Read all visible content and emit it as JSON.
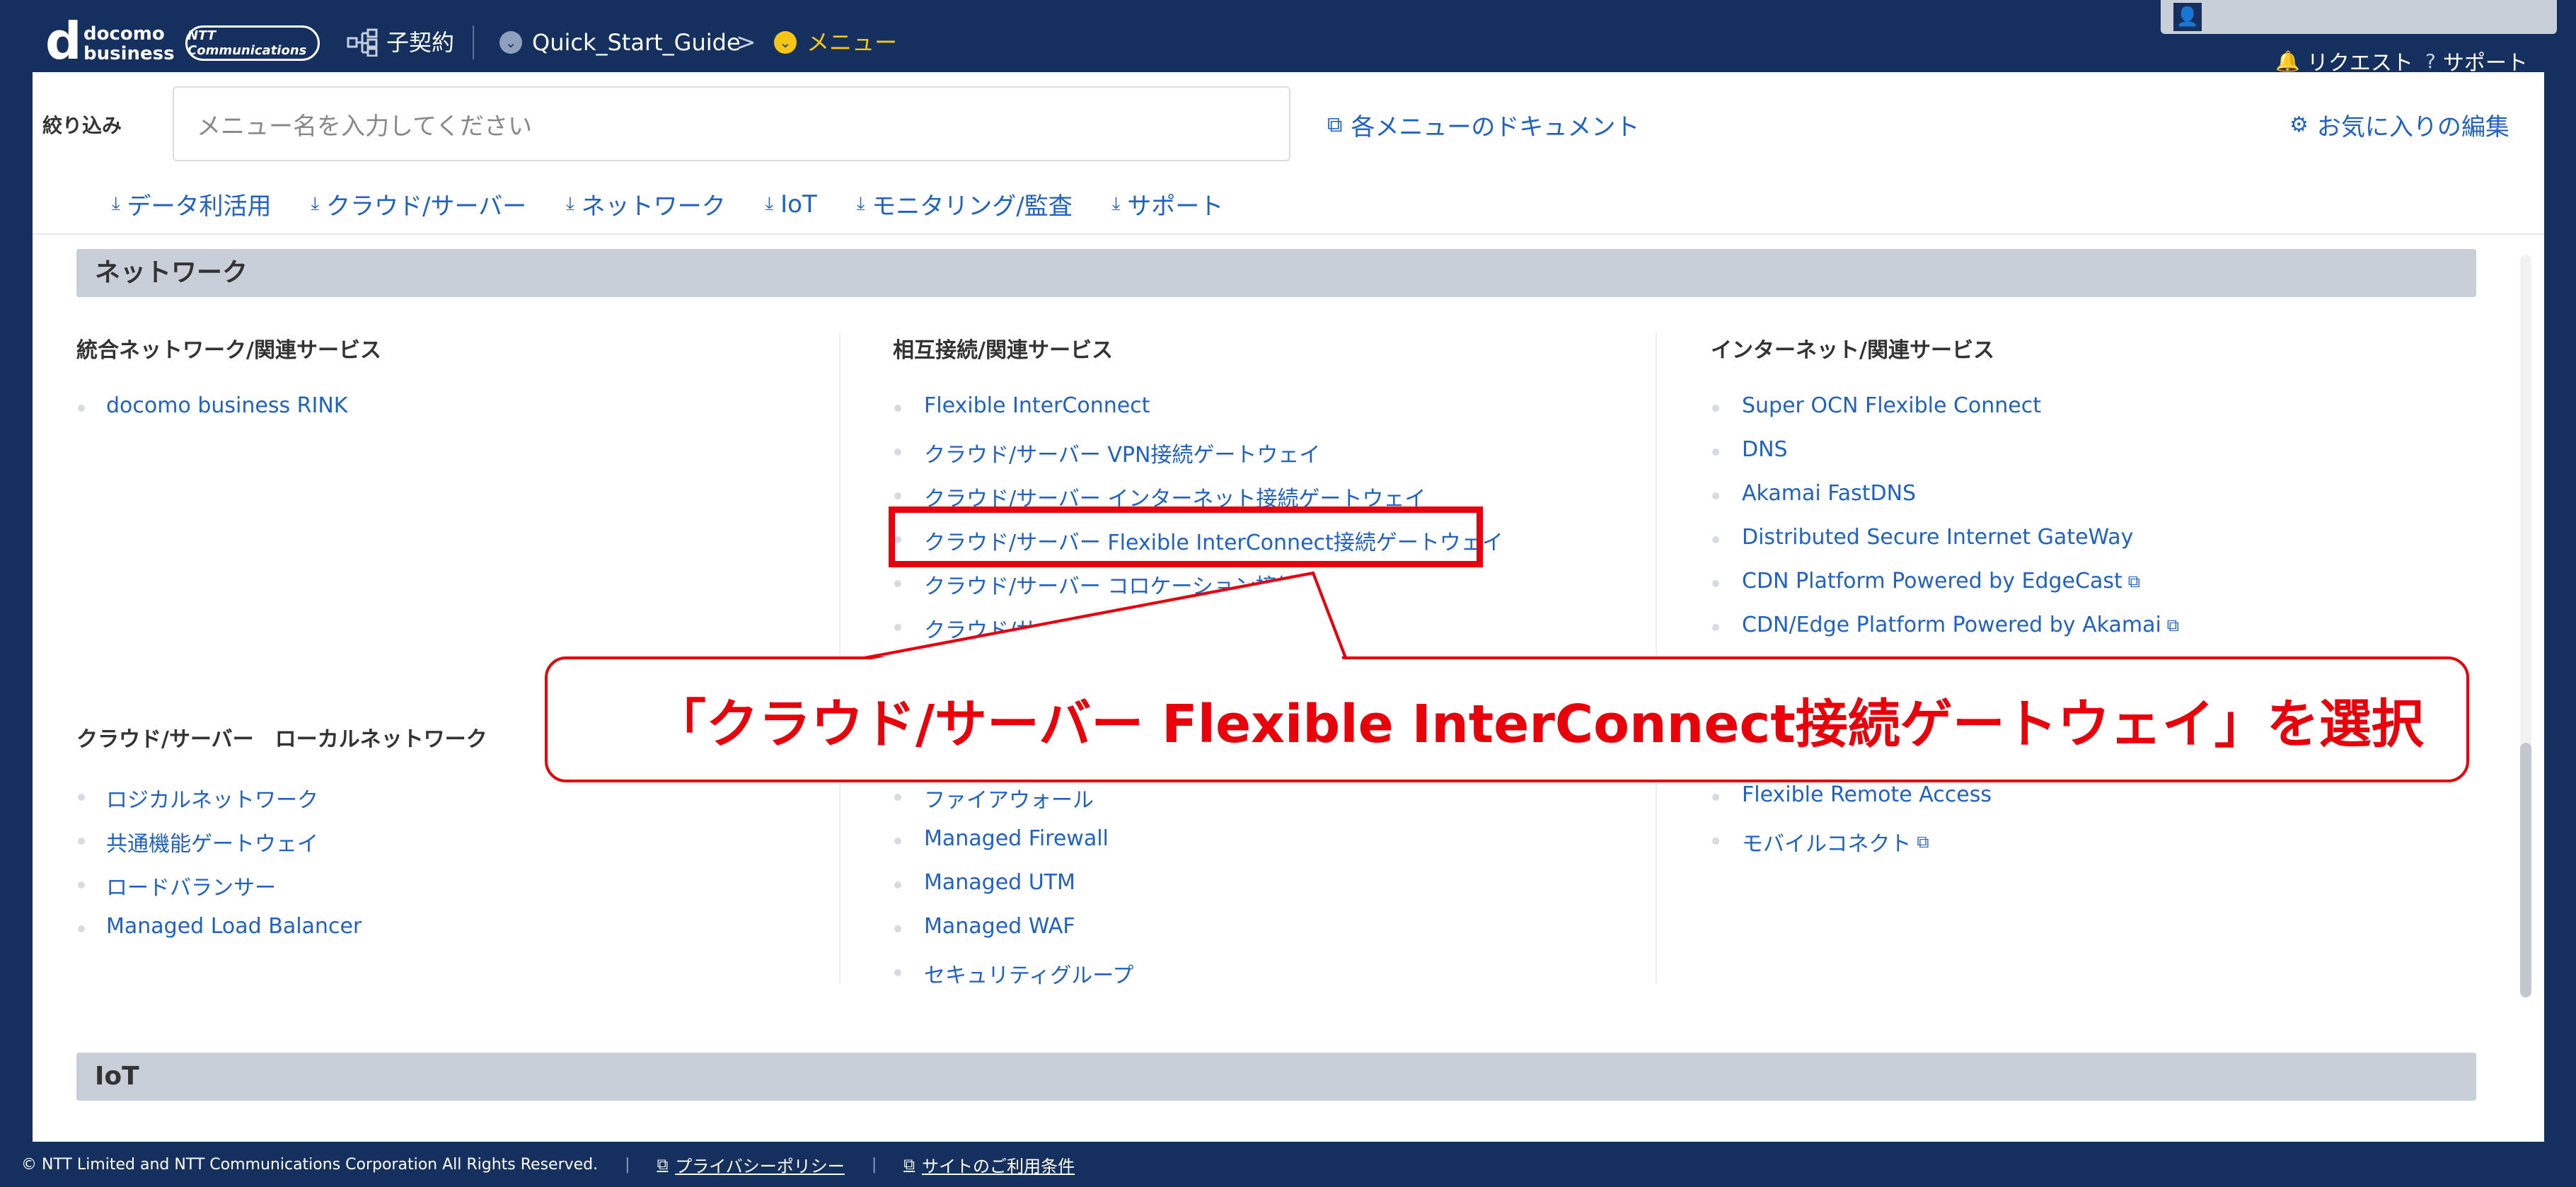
{
  "topbar": {
    "logo_d": "d",
    "logo_line1": "docomo",
    "logo_line2": "business",
    "ntt_logo": "NTT Communications",
    "contract_label": "子契約",
    "breadcrumb_1": "Quick_Start_Guide",
    "breadcrumb_sep": ">",
    "breadcrumb_2": "メニュー",
    "request_label": "リクエスト",
    "support_label": "サポート"
  },
  "filter": {
    "label": "絞り込み",
    "placeholder": "メニュー名を入力してください",
    "doc_link": "各メニューのドキュメント",
    "fav_link": "お気に入りの編集"
  },
  "categories": [
    "データ利活用",
    "クラウド/サーバー",
    "ネットワーク",
    "IoT",
    "モニタリング/監査",
    "サポート"
  ],
  "network_section": {
    "title": "ネットワーク",
    "col1_title": "統合ネットワーク/関連サービス",
    "col1_items": [
      "docomo business RINK"
    ],
    "col2_title": "相互接続/関連サービス",
    "col2_items": [
      "Flexible InterConnect",
      "クラウド/サーバー VPN接続ゲートウェイ",
      "クラウド/サーバー インターネット接続ゲートウェイ",
      "クラウド/サーバー Flexible InterConnect接続ゲートウェイ",
      "クラウド/サーバー コロケーション接続",
      "クラウド/サ"
    ],
    "col3_title": "インターネット/関連サービス",
    "col3_items": [
      "Super OCN Flexible Connect",
      "DNS",
      "Akamai FastDNS",
      "Distributed Secure Internet GateWay",
      "CDN Platform Powered by EdgeCast",
      "CDN/Edge Platform Powered by Akamai"
    ],
    "col1b_title": "クラウド/サーバー　ローカルネットワーク",
    "col1b_items": [
      "ロジカルネットワーク",
      "共通機能ゲートウェイ",
      "ロードバランサー",
      "Managed Load Balancer"
    ],
    "col2b_items": [
      "ファイアウォール",
      "Managed Firewall",
      "Managed UTM",
      "Managed WAF",
      "セキュリティグループ"
    ],
    "col3b_items": [
      "Flexible Remote Access",
      "モバイルコネクト"
    ]
  },
  "iot_section": {
    "title": "IoT"
  },
  "callout": {
    "text": "「クラウド/サーバー Flexible InterConnect接続ゲートウェイ」を選択"
  },
  "footer": {
    "copyright": "© NTT Limited and NTT Communications Corporation All Rights Reserved.",
    "privacy": "プライバシーポリシー",
    "terms": "サイトのご利用条件"
  },
  "colors": {
    "accent": "#1f62c4",
    "annotation": "#e8000b",
    "navy": "#15305e"
  }
}
